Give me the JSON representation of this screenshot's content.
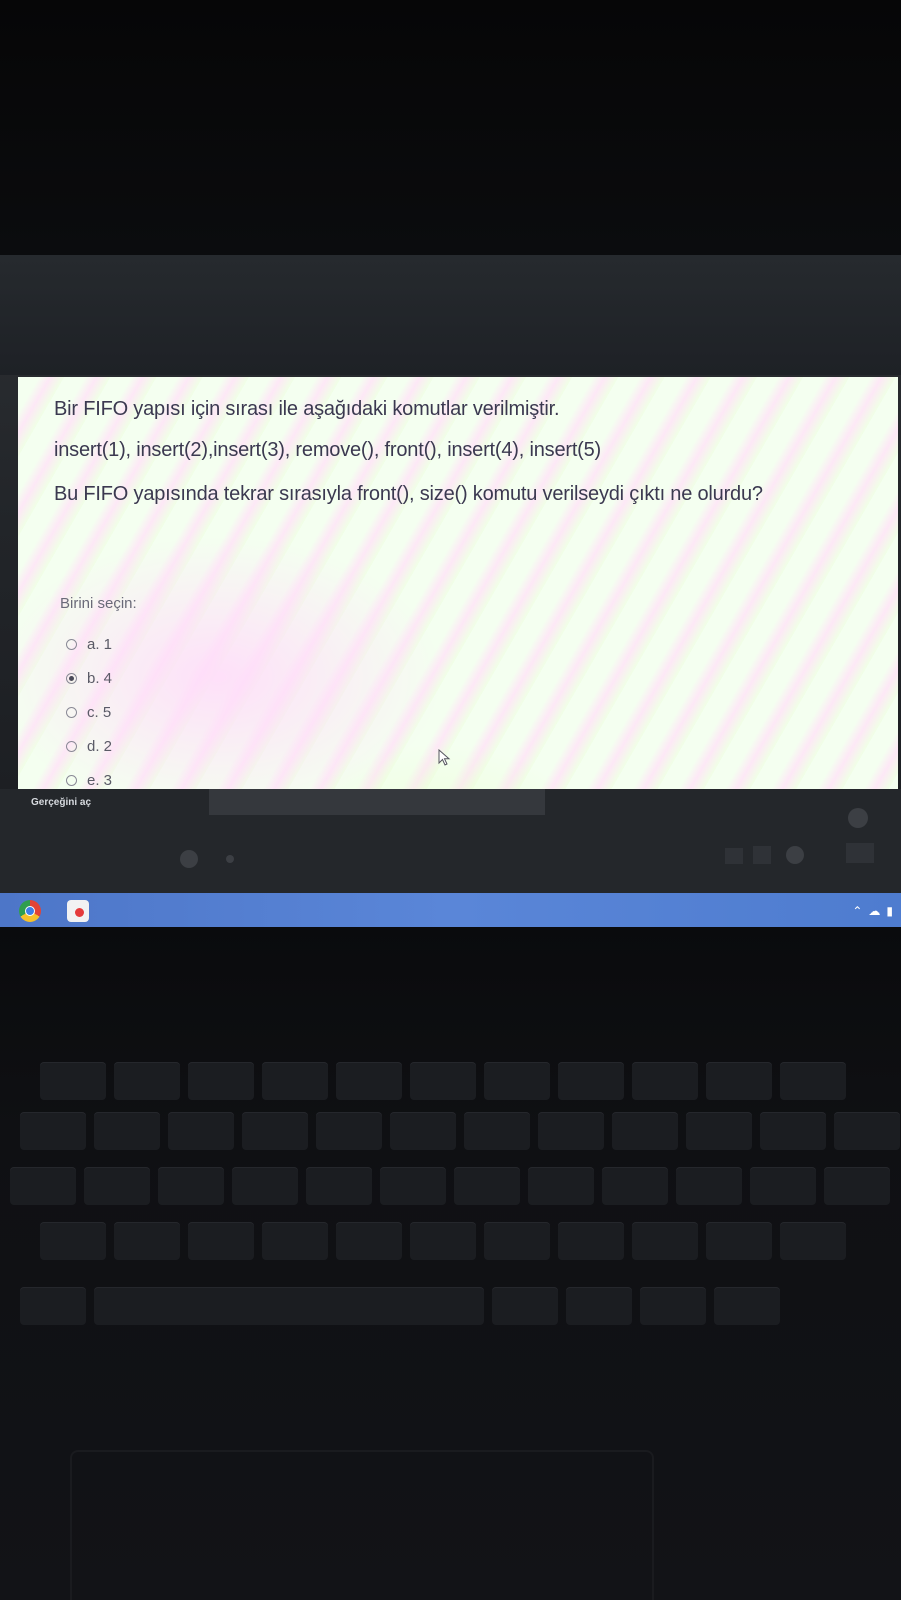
{
  "quiz": {
    "question_lines": [
      "Bir FIFO yapısı için sırası ile aşağıdaki komutlar verilmiştir.",
      "insert(1), insert(2),insert(3), remove(), front(), insert(4), insert(5)",
      "Bu FIFO yapısında tekrar sırasıyla front(), size()  komutu verilseydi çıktı ne olurdu?"
    ],
    "choose_label": "Birini seçin:",
    "options": [
      {
        "label": "a. 1",
        "selected": false
      },
      {
        "label": "b. 4",
        "selected": true
      },
      {
        "label": "c. 5",
        "selected": false
      },
      {
        "label": "d. 2",
        "selected": false
      },
      {
        "label": "e. 3",
        "selected": false
      }
    ]
  },
  "overlay": {
    "reality_label": "Gerçeğini aç"
  },
  "taskbar": {
    "icons": [
      "chrome-icon",
      "app-icon"
    ],
    "tray_icons": [
      "chevron-up-icon",
      "cloud-icon",
      "battery-icon"
    ],
    "accent_color": "#5a86d8"
  }
}
